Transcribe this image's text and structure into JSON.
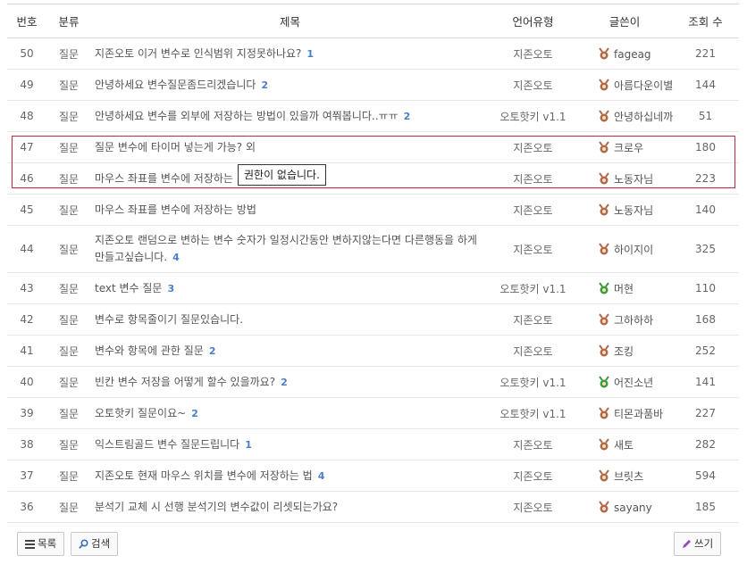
{
  "header": {
    "num": "번호",
    "category": "분류",
    "title": "제목",
    "lang": "언어유형",
    "author": "글쓴이",
    "views": "조회 수"
  },
  "rows": [
    {
      "num": "50",
      "category": "질문",
      "title": "지존오토 이거 변수로 인식범위 지정못하나요?",
      "comments": "1",
      "lang": "지존오토",
      "author": "fageag",
      "level_color": "#b06a4a",
      "views": "221"
    },
    {
      "num": "49",
      "category": "질문",
      "title": "안녕하세요 변수질문좀드리겠습니다",
      "comments": "2",
      "lang": "지존오토",
      "author": "아름다운이별",
      "level_color": "#b06a4a",
      "views": "144"
    },
    {
      "num": "48",
      "category": "질문",
      "title": "안녕하세요 변수를 외부에 저장하는 방법이 있을까 여쭤봅니다..ㅠㅠ",
      "comments": "2",
      "lang": "오토핫키 v1.1",
      "author": "안녕하십네까",
      "level_color": "#b06a4a",
      "views": "51"
    },
    {
      "num": "47",
      "category": "질문",
      "title": "질문 변수에 타이머 넣는게 가능? 외",
      "comments": "",
      "lang": "지존오토",
      "author": "크로우",
      "level_color": "#b06a4a",
      "views": "180"
    },
    {
      "num": "46",
      "category": "질문",
      "title": "마우스 좌표를 변수에 저장하는",
      "comments": "",
      "lang": "지존오토",
      "author": "노동자님",
      "level_color": "#b06a4a",
      "views": "223"
    },
    {
      "num": "45",
      "category": "질문",
      "title": "마우스 좌표를 변수에 저장하는 방법",
      "comments": "",
      "lang": "지존오토",
      "author": "노동자님",
      "level_color": "#b06a4a",
      "views": "140"
    },
    {
      "num": "44",
      "category": "질문",
      "title": "지존오토 랜덤으로 변하는 변수 숫자가 일정시간동안 변하지않는다면 다른행동을 하게 만들고싶습니다.",
      "comments": "4",
      "lang": "지존오토",
      "author": "하이지이",
      "level_color": "#b06a4a",
      "views": "325",
      "tall": true
    },
    {
      "num": "43",
      "category": "질문",
      "title": "text 변수 질문",
      "comments": "3",
      "lang": "오토핫키 v1.1",
      "author": "머현",
      "level_color": "#3d9a3d",
      "views": "110"
    },
    {
      "num": "42",
      "category": "질문",
      "title": "변수로 항목줄이기 질문있습니다.",
      "comments": "",
      "lang": "지존오토",
      "author": "그하하하",
      "level_color": "#b06a4a",
      "views": "168"
    },
    {
      "num": "41",
      "category": "질문",
      "title": "변수와 항목에 관한 질문",
      "comments": "2",
      "lang": "지존오토",
      "author": "조킹",
      "level_color": "#b06a4a",
      "views": "252"
    },
    {
      "num": "40",
      "category": "질문",
      "title": "빈칸 변수 저장을 어떻게 할수 있을까요?",
      "comments": "2",
      "lang": "오토핫키 v1.1",
      "author": "어진소년",
      "level_color": "#3d9a3d",
      "views": "141"
    },
    {
      "num": "39",
      "category": "질문",
      "title": "오토핫키 질문이요~",
      "comments": "2",
      "lang": "오토핫키 v1.1",
      "author": "티몬과품바",
      "level_color": "#b06a4a",
      "views": "227"
    },
    {
      "num": "38",
      "category": "질문",
      "title": "익스트림골드 변수 질문드립니다",
      "comments": "1",
      "lang": "지존오토",
      "author": "새토",
      "level_color": "#b06a4a",
      "views": "282"
    },
    {
      "num": "37",
      "category": "질문",
      "title": "지존오토 현재 마우스 위치를 변수에 저장하는 법",
      "comments": "4",
      "lang": "지존오토",
      "author": "브릿츠",
      "level_color": "#b06a4a",
      "views": "594"
    },
    {
      "num": "36",
      "category": "질문",
      "title": "분석기 교체 시 선행 분석기의 변수값이 리셋되는가요?",
      "comments": "",
      "lang": "지존오토",
      "author": "sayany",
      "level_color": "#b06a4a",
      "views": "185"
    }
  ],
  "tooltip": "권한이 없습니다.",
  "buttons": {
    "list": "목록",
    "search": "검색",
    "write": "쓰기"
  },
  "colors": {
    "highlight_border": "#c8283b",
    "comment_count": "#4a7fc7"
  }
}
